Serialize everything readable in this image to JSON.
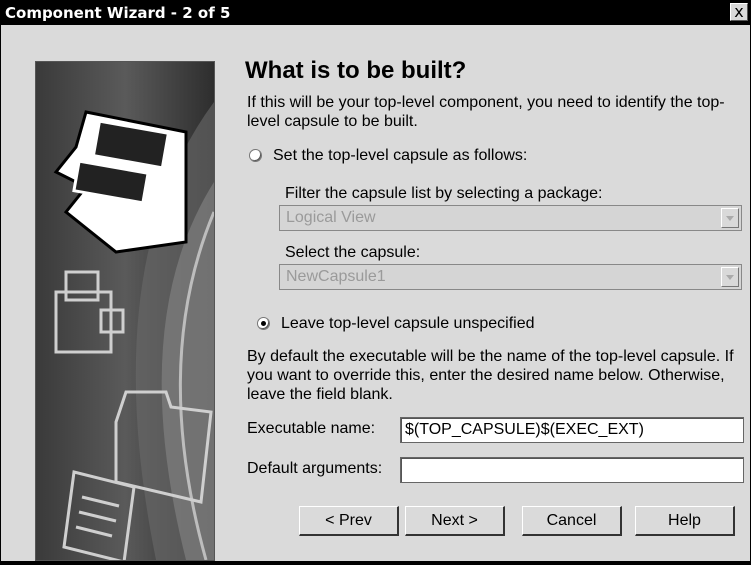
{
  "window": {
    "title": "Component Wizard - 2 of 5",
    "close_label": "x"
  },
  "main": {
    "heading": "What is to be built?",
    "intro": "If this will be your top-level component, you need to identify the top-level capsule to be built.",
    "option_set": {
      "label": "Set the top-level capsule as follows:",
      "selected": false,
      "filter_label": "Filter the capsule list by selecting a package:",
      "filter_value": "Logical View",
      "capsule_label": "Select the capsule:",
      "capsule_value": "NewCapsule1"
    },
    "option_unspecified": {
      "label": "Leave top-level capsule unspecified",
      "selected": true
    },
    "note": "By default the executable will be the name of the top-level capsule.  If you want to override this, enter the desired name below.  Otherwise, leave the field blank.",
    "exec_label": "Executable name:",
    "exec_value": "$(TOP_CAPSULE)$(EXEC_EXT)",
    "args_label": "Default arguments:",
    "args_value": ""
  },
  "buttons": {
    "prev": "< Prev",
    "next": "Next >",
    "cancel": "Cancel",
    "help": "Help"
  }
}
